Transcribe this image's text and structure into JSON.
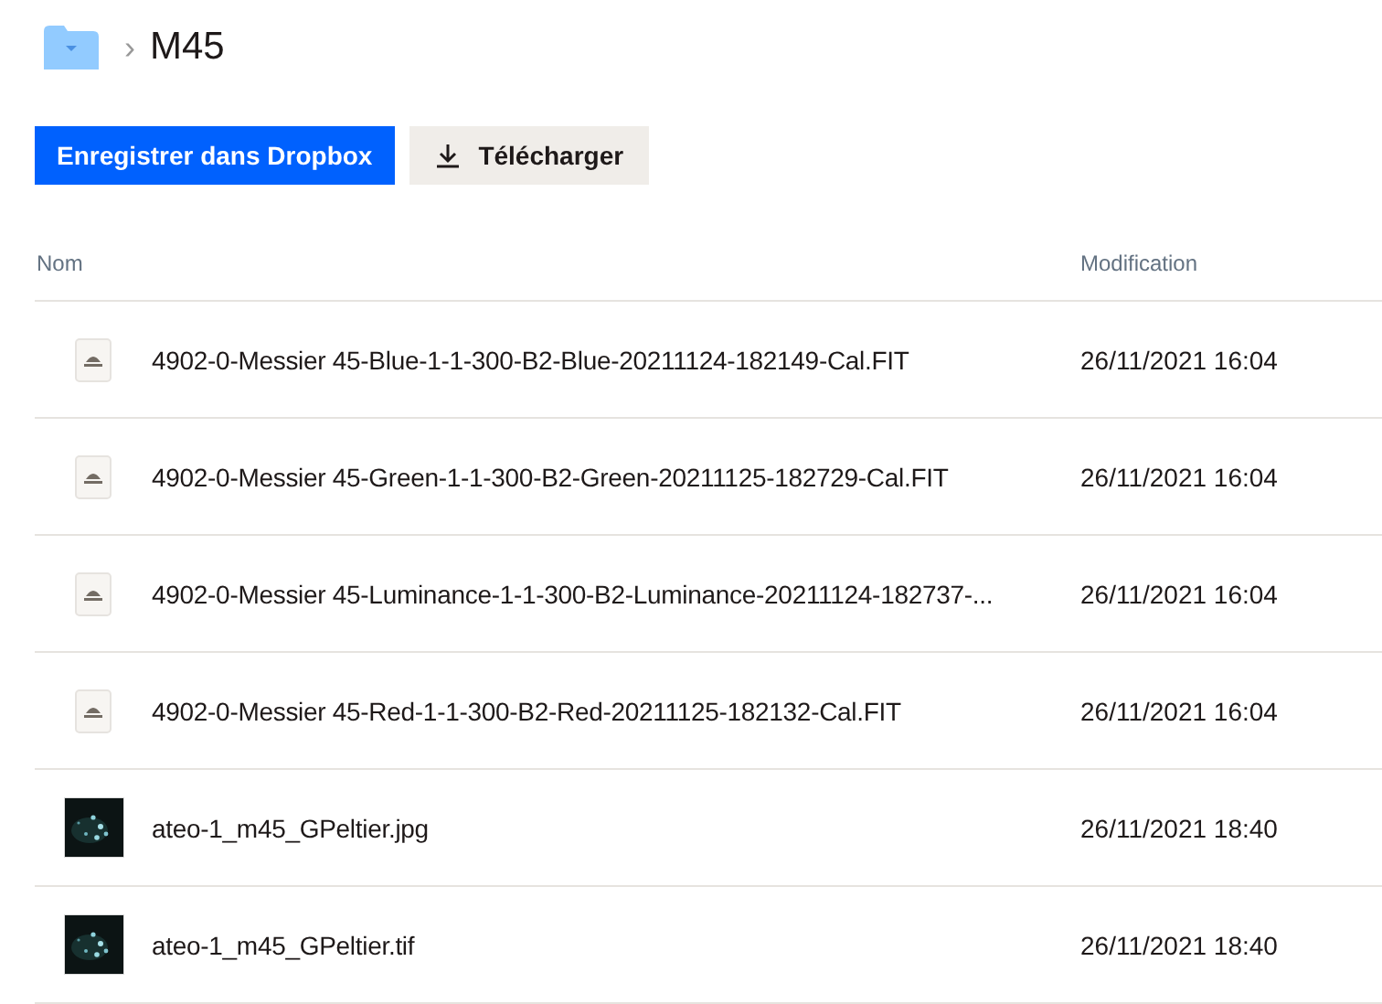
{
  "breadcrumb": {
    "separator": "›",
    "title": "M45"
  },
  "buttons": [
    {
      "label": "Enregistrer dans Dropbox",
      "kind": "primary"
    },
    {
      "label": "Télécharger",
      "kind": "download"
    }
  ],
  "table": {
    "columns": [
      "Nom",
      "Modification"
    ],
    "rows": [
      {
        "kind": "file",
        "name": "4902-0-Messier 45-Blue-1-1-300-B2-Blue-20211124-182149-Cal.FIT",
        "modified": "26/11/2021 16:04"
      },
      {
        "kind": "file",
        "name": "4902-0-Messier 45-Green-1-1-300-B2-Green-20211125-182729-Cal.FIT",
        "modified": "26/11/2021 16:04"
      },
      {
        "kind": "file",
        "name": "4902-0-Messier 45-Luminance-1-1-300-B2-Luminance-20211124-182737-...",
        "modified": "26/11/2021 16:04"
      },
      {
        "kind": "file",
        "name": "4902-0-Messier 45-Red-1-1-300-B2-Red-20211125-182132-Cal.FIT",
        "modified": "26/11/2021 16:04"
      },
      {
        "name": "ateo-1_m45_GPeltier.jpg",
        "modified": "26/11/2021 18:40"
      },
      {
        "name": "ateo-1_m45_GPeltier.tif",
        "modified": "26/11/2021 18:40"
      }
    ]
  }
}
